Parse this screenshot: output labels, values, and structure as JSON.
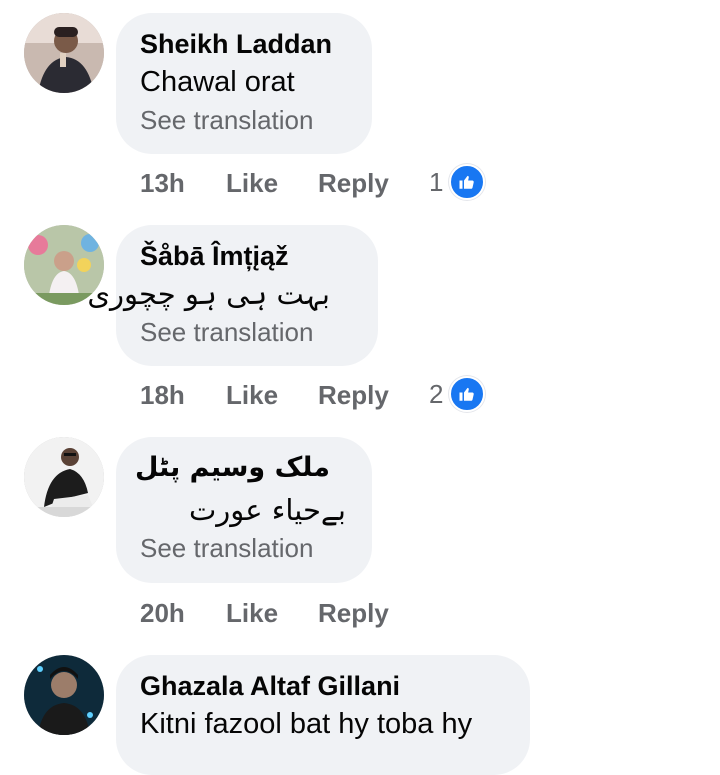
{
  "comments": [
    {
      "author": "Sheikh Laddan",
      "text": "Chawal orat",
      "translate_label": "See translation",
      "time": "13h",
      "like_label": "Like",
      "reply_label": "Reply",
      "like_count": "1",
      "avatar_icon": "avatar-photo"
    },
    {
      "author": "Šåbā Îmțįąž",
      "text": "بہت ہی ہو چچوری",
      "translate_label": "See translation",
      "time": "18h",
      "like_label": "Like",
      "reply_label": "Reply",
      "like_count": "2",
      "avatar_icon": "avatar-photo"
    },
    {
      "author": "ملک وسیم پٹل",
      "text": "بےحیاء عورت",
      "translate_label": "See translation",
      "time": "20h",
      "like_label": "Like",
      "reply_label": "Reply",
      "avatar_icon": "avatar-photo"
    },
    {
      "author": "Ghazala Altaf Gillani",
      "text": "Kitni fazool bat hy toba hy",
      "avatar_icon": "avatar-photo"
    }
  ],
  "colors": {
    "bubble": "#f0f2f5",
    "meta_text": "#65676b",
    "like_blue": "#1877f2"
  }
}
